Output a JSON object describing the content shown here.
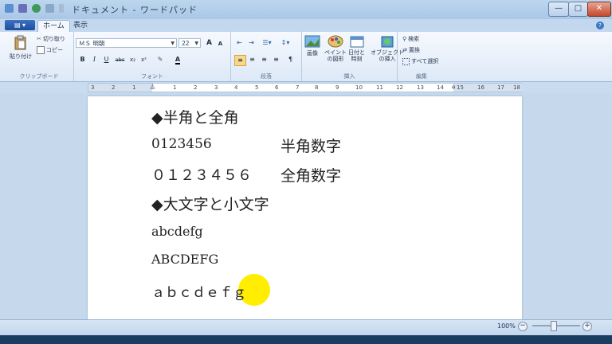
{
  "window": {
    "title": "ドキュメント - ワードパッド",
    "controls": {
      "minimize": "—",
      "maximize": "□",
      "close": "✕"
    }
  },
  "tabs": {
    "file": "",
    "home": "ホーム",
    "view": "表示",
    "help": "?"
  },
  "ribbon": {
    "clipboard": {
      "paste": "貼り付け",
      "cut": "切り取り",
      "copy": "コピー",
      "label": "クリップボード"
    },
    "font": {
      "family": "ＭＳ 明朝",
      "size": "22",
      "grow": "A",
      "shrink": "A",
      "bold": "B",
      "italic": "I",
      "underline": "U",
      "strike": "abc",
      "sub": "x₂",
      "sup": "x²",
      "label": "フォント"
    },
    "paragraph": {
      "label": "段落"
    },
    "insert": {
      "picture": "画像",
      "paint": "ペイント\nの図形",
      "datetime": "日付と\n時刻",
      "object": "オブジェクト\nの挿入",
      "label": "挿入"
    },
    "edit": {
      "find": "検索",
      "replace": "置換",
      "selectall": "すべて選択",
      "label": "編集"
    }
  },
  "ruler": {
    "ticks": [
      "3",
      "2",
      "1",
      "1",
      "2",
      "3",
      "4",
      "5",
      "6",
      "7",
      "8",
      "9",
      "10",
      "11",
      "12",
      "13",
      "14",
      "15",
      "16",
      "17",
      "18"
    ]
  },
  "document": {
    "lines": [
      "◆半角と全角",
      "0123456",
      "半角数字",
      "０１２３４５６",
      "全角数字",
      "◆大文字と小文字",
      "abcdefg",
      "ABCDEFG",
      "ａｂｃｄｅｆｇ"
    ]
  },
  "status": {
    "zoom": "100%",
    "zoom_out": "−",
    "zoom_in": "+"
  },
  "colors": {
    "cursor_highlight": "#ffee00",
    "ribbon": "#dde9f7",
    "titlebar": "#bcd6ee"
  }
}
